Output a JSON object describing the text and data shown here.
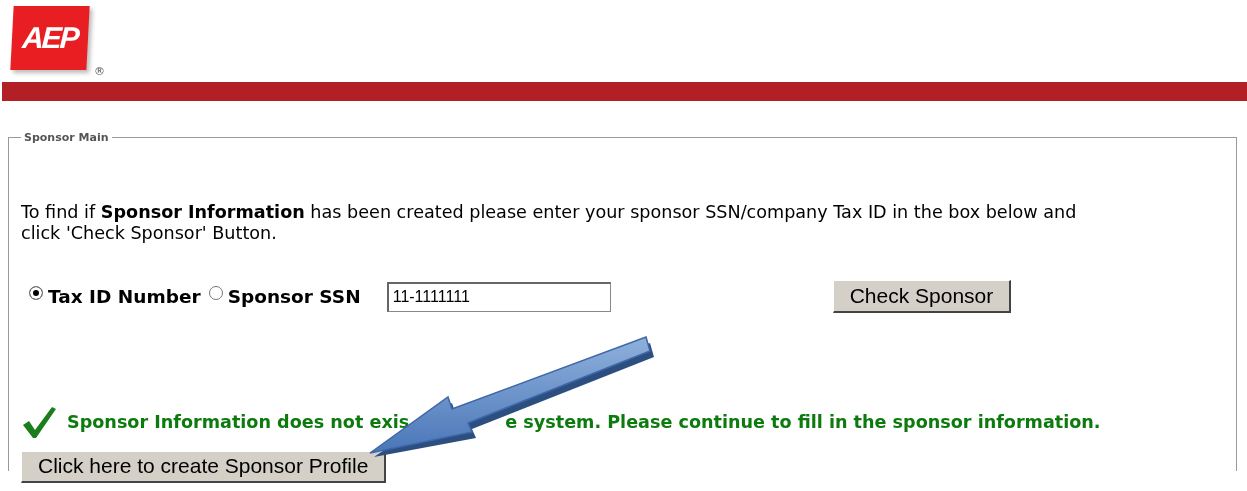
{
  "logo": {
    "text": "AEP",
    "mark": "®"
  },
  "panel": {
    "legend": "Sponsor Main",
    "instructions": "To find if **Sponsor Information** has been created please enter your sponsor SSN/company Tax ID in the box below and click 'Check Sponsor' Button.",
    "id_types": [
      {
        "label": "Tax ID Number",
        "selected": true
      },
      {
        "label": "Sponsor SSN",
        "selected": false
      }
    ],
    "id_field": {
      "value": "11-1111111"
    },
    "check_button": "Check Sponsor",
    "message": {
      "kind": "success",
      "before_arrow": "Sponsor Information does not exis",
      "after_arrow": "e system. Please continue to fill in the sponsor information."
    },
    "create_button": "Click here to create Sponsor Profile"
  }
}
